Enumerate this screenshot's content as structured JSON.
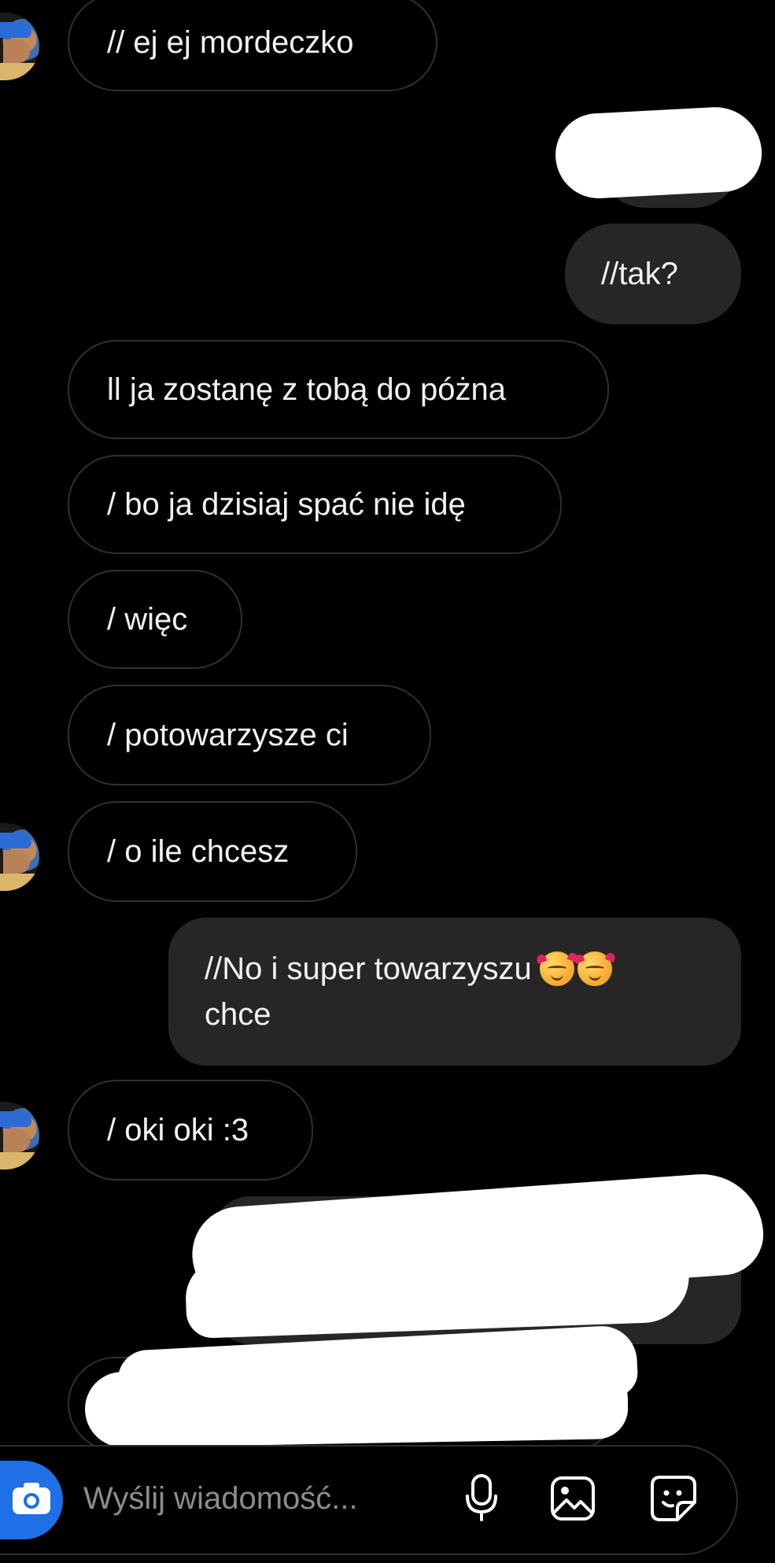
{
  "messages": [
    {
      "direction": "in",
      "text": "// ej ej mordeczko"
    },
    {
      "direction": "out",
      "text": "//tak?"
    },
    {
      "direction": "in",
      "text": "ll ja zostanę z tobą do póżna"
    },
    {
      "direction": "in",
      "text": "/ bo ja dzisiaj spać nie idę"
    },
    {
      "direction": "in",
      "text": "/ więc"
    },
    {
      "direction": "in",
      "text": "/ potowarzysze ci"
    },
    {
      "direction": "in",
      "text": "/ o ile chcesz"
    },
    {
      "direction": "out",
      "text_line1": "//No i super towarzyszu",
      "text_line2": "chce",
      "emojis": [
        "smiling-face-with-hearts",
        "smiling-face-with-hearts"
      ]
    },
    {
      "direction": "in",
      "text": "/ oki oki :3"
    }
  ],
  "composer": {
    "placeholder": "Wyślij wiadomość...",
    "camera_icon": "camera-icon",
    "mic_icon": "microphone-icon",
    "gallery_icon": "image-icon",
    "sticker_icon": "sticker-icon"
  },
  "colors": {
    "background": "#000000",
    "outgoing_bubble": "#262626",
    "incoming_border": "#2f2f2f",
    "camera_button": "#1f6fe6",
    "placeholder": "#8c8c8c"
  }
}
